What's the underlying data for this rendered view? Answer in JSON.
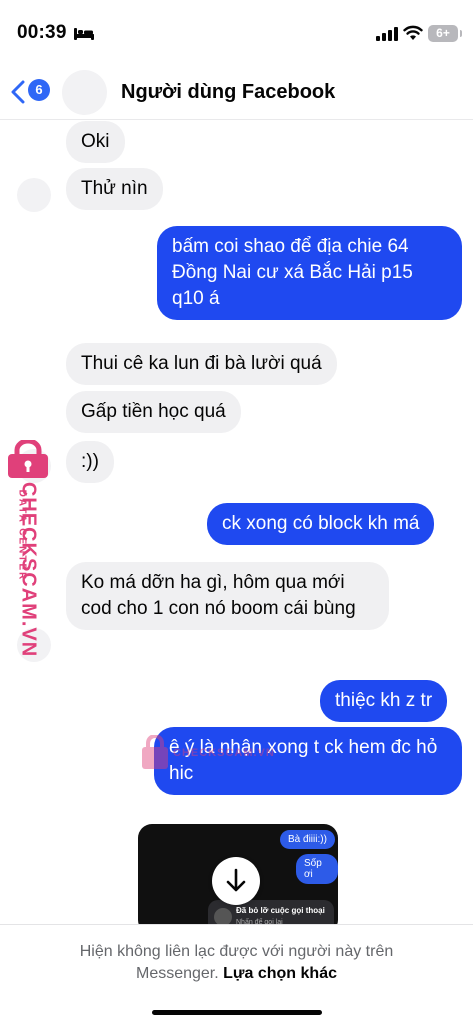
{
  "status_bar": {
    "time": "00:39",
    "battery": "6+"
  },
  "header": {
    "back_badge": "6",
    "title": "Người dùng Facebook"
  },
  "messages": [
    {
      "direction": "in",
      "text": "Oki"
    },
    {
      "direction": "in",
      "text": "Thử nìn"
    },
    {
      "direction": "out",
      "text": "bấm coi shao để địa chie 64 Đồng Nai cư xá Bắc Hải p15 q10 á"
    },
    {
      "direction": "in",
      "text": "Thui cê ka lun đi bà lười quá"
    },
    {
      "direction": "in",
      "text": "Gấp tiền học quá"
    },
    {
      "direction": "in",
      "text": ":))"
    },
    {
      "direction": "out",
      "text": "ck xong có block kh má"
    },
    {
      "direction": "in",
      "text": "Ko má dỡn ha gì, hôm qua mới cod cho 1 con nó boom cái bùng"
    },
    {
      "direction": "out",
      "text": "thiệc kh z tr"
    },
    {
      "direction": "out",
      "text": "ê ý là nhận xong t ck hem đc hỏ hic"
    }
  ],
  "media": {
    "bubble_1": "Bà điiii:))",
    "bubble_2": "Sốp ơi",
    "call_title": "Đã bỏ lỡ cuộc gọi thoại",
    "call_subtitle": "Nhấn để gọi lại"
  },
  "watermark": {
    "brand": "CHECKSCAM.VN",
    "tagline": "DATA CENTER"
  },
  "footer": {
    "notice": "Hiện không liên lạc được với người này trên Messenger.",
    "link": "Lựa chọn khác"
  },
  "colors": {
    "outgoing_bubble": "#1f49f0",
    "incoming_bubble": "#f0f0f2",
    "accent": "#2f67f6",
    "watermark": "#e0407a"
  },
  "icons": [
    "bed-icon",
    "signal-icon",
    "wifi-icon",
    "back-arrow-icon",
    "download-icon",
    "phone-icon",
    "lock-icon"
  ]
}
